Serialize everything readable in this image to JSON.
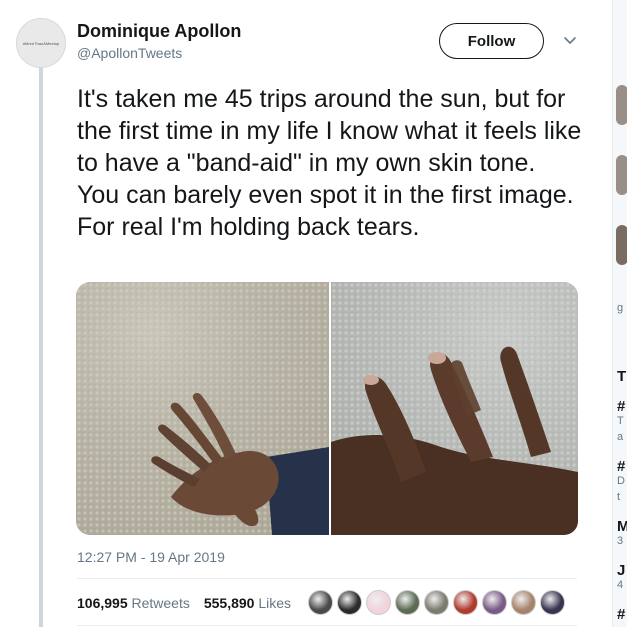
{
  "author": {
    "display_name": "Dominique Apollon",
    "handle": "@ApollonTweets",
    "avatar_text": "#MoreThanAMeetup"
  },
  "actions": {
    "follow_label": "Follow"
  },
  "tweet": {
    "text": "It's taken me 45 trips around the sun, but for the first time in my life I know what it feels like to have a \"band-aid\" in my own skin tone. You can barely even spot it in the first image. For real I'm holding back tears.",
    "timestamp": "12:27 PM - 19 Apr 2019"
  },
  "stats": {
    "retweets_count": "106,995",
    "retweets_label": "Retweets",
    "likes_count": "555,890",
    "likes_label": "Likes"
  },
  "likers": [
    {
      "color": "#4a4a4a"
    },
    {
      "color": "#2b2b2b"
    },
    {
      "color": "#f2d3dc"
    },
    {
      "color": "#5c6b54"
    },
    {
      "color": "#7b7b6e"
    },
    {
      "color": "#b03a2e"
    },
    {
      "color": "#7a5a86"
    },
    {
      "color": "#a8836b"
    },
    {
      "color": "#3a3450"
    }
  ],
  "sidebar_fragments": [
    {
      "text": "g",
      "style": "gray"
    },
    {
      "text": "T",
      "style": "bold"
    },
    {
      "text": "#",
      "style": "bold"
    },
    {
      "text": "T",
      "style": "gray"
    },
    {
      "text": "a",
      "style": "gray"
    },
    {
      "text": "#",
      "style": "bold"
    },
    {
      "text": "D",
      "style": "gray"
    },
    {
      "text": "t",
      "style": "gray"
    },
    {
      "text": "M",
      "style": "bold"
    },
    {
      "text": "3",
      "style": "gray"
    },
    {
      "text": "J",
      "style": "bold"
    },
    {
      "text": "4",
      "style": "gray"
    },
    {
      "text": "#",
      "style": "bold"
    }
  ]
}
